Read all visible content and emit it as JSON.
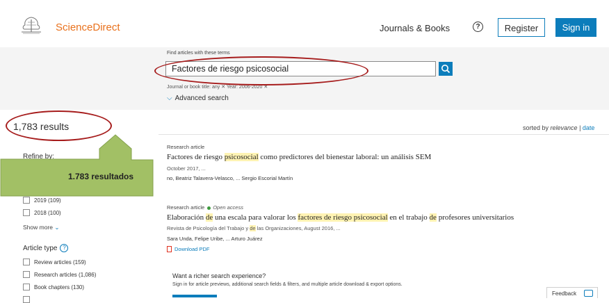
{
  "header": {
    "brand": "ScienceDirect",
    "nav_journals": "Journals & Books",
    "help_icon_glyph": "?",
    "register_label": "Register",
    "signin_label": "Sign in"
  },
  "search": {
    "find_label": "Find articles with these terms",
    "query": "Factores de riesgo psicosocial",
    "filters_line": "Journal or book title: any ✕   Year: 2006-2020 ✕",
    "advanced_label": "Advanced search"
  },
  "results": {
    "count": "1,783 results",
    "sorted_prefix": "sorted by ",
    "sorted_relevance": "relevance",
    "sorted_sep": " | ",
    "sorted_date": "date"
  },
  "sidebar": {
    "filter_heading": "Refine by:",
    "years": [
      {
        "label": "2019 (109)"
      },
      {
        "label": "2018 (100)"
      }
    ],
    "show_more": "Show more",
    "article_type_heading": "Article type",
    "article_types": [
      {
        "label": "Review articles (159)"
      },
      {
        "label": "Research articles (1,086)"
      },
      {
        "label": "Book chapters (130)"
      }
    ]
  },
  "items": [
    {
      "type": "Research article",
      "title_pre": "Factores de riesgo ",
      "title_hl": "psicosocial",
      "title_post": " como predictores del bienestar laboral: un análisis SEM",
      "meta": "October 2017, ...",
      "authors": "no, Beatriz Talavera-Velasco, ... Sergio Escorial Martín"
    },
    {
      "type": "Research article",
      "open_access": "Open access",
      "title_parts": [
        "Elaboración ",
        "de",
        " una escala para valorar los ",
        "factores de riesgo psicosocial",
        " en el trabajo ",
        "de",
        " profesores universitarios"
      ],
      "meta_pre": "Revista de Psicología del Trabajo y ",
      "meta_hl": "de",
      "meta_post": " las Organizaciones, August 2016, ...",
      "authors": "Sara Unda, Felipe Uribe, ... Arturo Juárez",
      "download": "Download PDF"
    }
  ],
  "promo": {
    "title": "Want a richer search experience?",
    "subtitle": "Sign in for article previews, additional search fields & filters, and multiple article download & export options."
  },
  "feedback_label": "Feedback",
  "annotation": {
    "callout_text": "1.783 resultados",
    "callout_color": "#9bbb59",
    "oval_color": "#a61c1c"
  },
  "colors": {
    "brand_orange": "#e9711c",
    "accent_blue": "#0c7dbb"
  }
}
